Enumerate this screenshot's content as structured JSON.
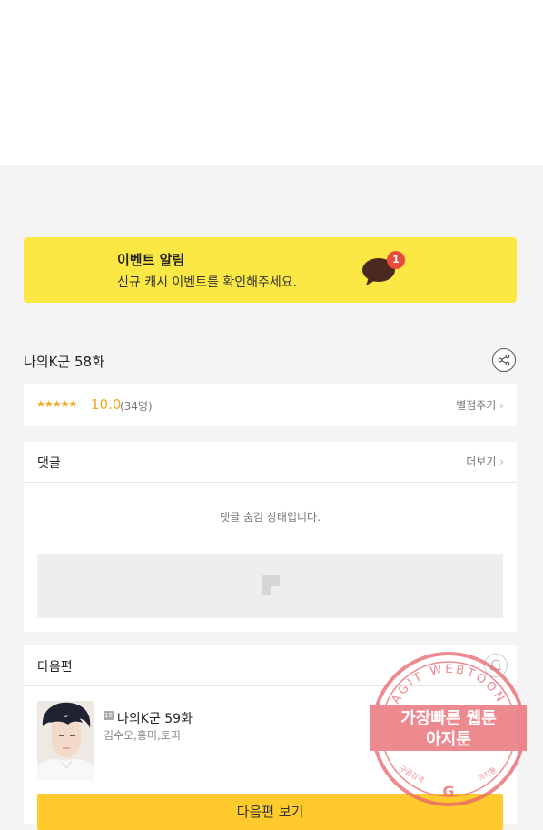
{
  "event": {
    "title": "이벤트 알림",
    "description": "신규 캐시 이벤트를 확인해주세요.",
    "badge_count": "1"
  },
  "episode": {
    "title": "나의K군 58화"
  },
  "rating": {
    "stars": "★★★★★",
    "score": "10.0",
    "count": "(34명)",
    "rate_label": "별점주기"
  },
  "comments": {
    "heading": "댓글",
    "more_label": "더보기",
    "hidden_message": "댓글 숨김 상태입니다."
  },
  "next": {
    "heading": "다음편",
    "age_rating": "15",
    "title": "나의K군 59화",
    "authors": "김수오,홍미,토피",
    "button_label": "다음편 보기"
  },
  "watermark": {
    "line1": "가장빠른 웹툰",
    "line2": "아지툰",
    "ring_text": "AGIT WEBTOON",
    "bottom_left": "구글검색",
    "bottom_right": "아지툰"
  },
  "colors": {
    "event_bg": "#fce845",
    "accent_star": "#f5a623",
    "next_button": "#ffcb2c",
    "badge": "#e94b3c",
    "watermark": "#e8636a"
  }
}
